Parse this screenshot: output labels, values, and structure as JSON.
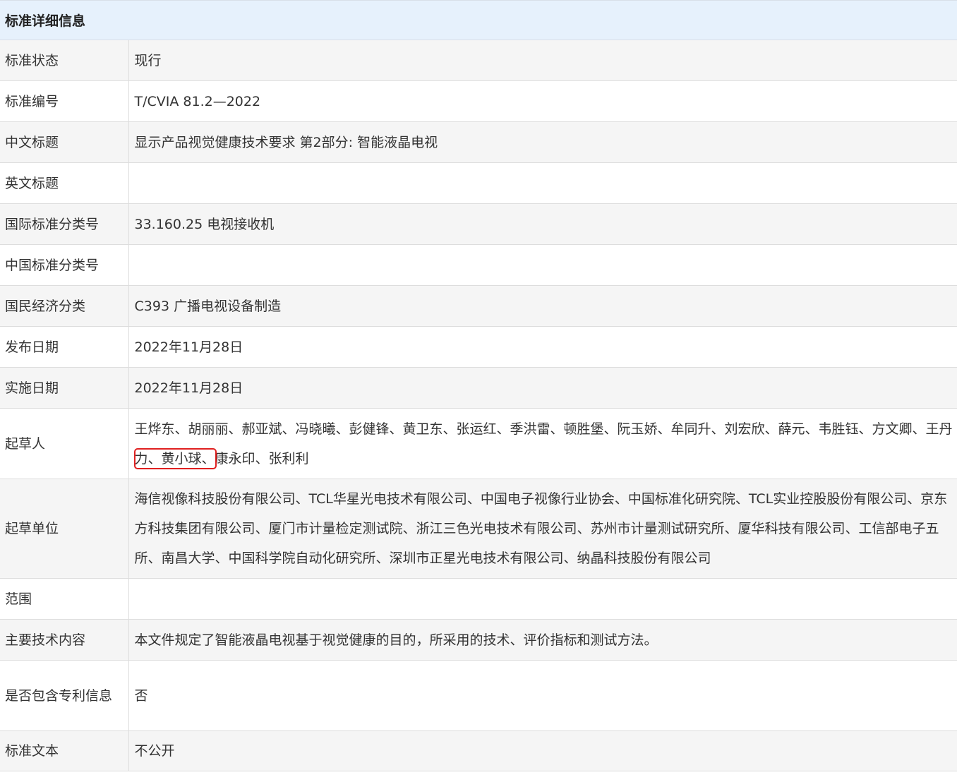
{
  "header": {
    "title": "标准详细信息"
  },
  "fields": {
    "status": {
      "label": "标准状态",
      "value": "现行"
    },
    "number": {
      "label": "标准编号",
      "value": "T/CVIA 81.2—2022"
    },
    "cn_title": {
      "label": "中文标题",
      "value": "显示产品视觉健康技术要求 第2部分: 智能液晶电视"
    },
    "en_title": {
      "label": "英文标题",
      "value": ""
    },
    "ics": {
      "label": "国际标准分类号",
      "value": "33.160.25 电视接收机"
    },
    "ccs": {
      "label": "中国标准分类号",
      "value": ""
    },
    "economy": {
      "label": "国民经济分类",
      "value": "C393 广播电视设备制造"
    },
    "publish_date": {
      "label": "发布日期",
      "value": "2022年11月28日"
    },
    "implement_date": {
      "label": "实施日期",
      "value": "2022年11月28日"
    },
    "drafters": {
      "label": "起草人",
      "value_before": "王烨东、胡丽丽、郝亚斌、冯晓曦、彭健锋、黄卫东、张运红、季洪雷、顿胜堡、阮玉娇、牟同升、刘宏欣、薛元、韦胜钰、方文卿、王丹力",
      "value_highlight": "、黄小球、",
      "value_after": "康永印、张利利"
    },
    "drafting_units": {
      "label": "起草单位",
      "value": "海信视像科技股份有限公司、TCL华星光电技术有限公司、中国电子视像行业协会、中国标准化研究院、TCL实业控股股份有限公司、京东方科技集团有限公司、厦门市计量检定测试院、浙江三色光电技术有限公司、苏州市计量测试研究所、厦华科技有限公司、工信部电子五所、南昌大学、中国科学院自动化研究所、深圳市正星光电技术有限公司、纳晶科技股份有限公司"
    },
    "scope": {
      "label": "范围",
      "value": ""
    },
    "main_content": {
      "label": "主要技术内容",
      "value": "本文件规定了智能液晶电视基于视觉健康的目的，所采用的技术、评价指标和测试方法。"
    },
    "patent": {
      "label": "是否包含专利信息",
      "value": "否"
    },
    "text": {
      "label": "标准文本",
      "value": "不公开"
    }
  },
  "colors": {
    "header_bg": "#e6f1fc",
    "row_alt_bg": "#f5f5f5",
    "highlight": "#e02020"
  }
}
